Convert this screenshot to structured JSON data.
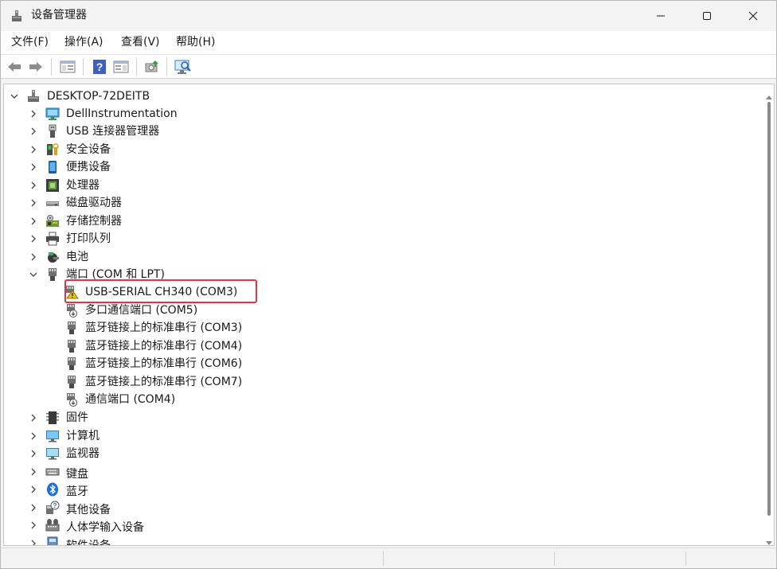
{
  "window": {
    "title": "设备管理器",
    "app_icon": "device-manager-icon"
  },
  "menu": [
    {
      "label": "文件(F)"
    },
    {
      "label": "操作(A)"
    },
    {
      "label": "查看(V)"
    },
    {
      "label": "帮助(H)"
    }
  ],
  "toolbar": [
    {
      "name": "back-arrow-icon"
    },
    {
      "name": "forward-arrow-icon"
    },
    {
      "name": "show-hide-console-tree-icon"
    },
    {
      "name": "help-icon"
    },
    {
      "name": "action-pane-icon"
    },
    {
      "name": "update-driver-icon"
    },
    {
      "name": "scan-hardware-changes-icon"
    }
  ],
  "tree": {
    "root": {
      "label": "DESKTOP-72DEITB",
      "icon": "computer-tower-icon",
      "expanded": true
    },
    "categories": [
      {
        "label": "DellInstrumentation",
        "icon": "network-monitor-icon",
        "expanded": false
      },
      {
        "label": "USB 连接器管理器",
        "icon": "usb-plug-icon",
        "expanded": false
      },
      {
        "label": "安全设备",
        "icon": "security-key-icon",
        "expanded": false
      },
      {
        "label": "便携设备",
        "icon": "portable-device-icon",
        "expanded": false
      },
      {
        "label": "处理器",
        "icon": "processor-chip-icon",
        "expanded": false
      },
      {
        "label": "磁盘驱动器",
        "icon": "disk-drive-icon",
        "expanded": false
      },
      {
        "label": "存储控制器",
        "icon": "storage-controller-icon",
        "expanded": false
      },
      {
        "label": "打印队列",
        "icon": "printer-icon",
        "expanded": false
      },
      {
        "label": "电池",
        "icon": "battery-icon",
        "expanded": false
      },
      {
        "label": "端口 (COM 和 LPT)",
        "icon": "port-connector-icon",
        "expanded": true,
        "children": [
          {
            "label": "USB-SERIAL CH340 (COM3)",
            "icon": "warning-port-icon",
            "status": "warning",
            "highlighted": true
          },
          {
            "label": "多口通信端口 (COM5)",
            "icon": "comm-port-icon"
          },
          {
            "label": "蓝牙链接上的标准串行 (COM3)",
            "icon": "port-connector-icon"
          },
          {
            "label": "蓝牙链接上的标准串行 (COM4)",
            "icon": "port-connector-icon"
          },
          {
            "label": "蓝牙链接上的标准串行 (COM6)",
            "icon": "port-connector-icon"
          },
          {
            "label": "蓝牙链接上的标准串行 (COM7)",
            "icon": "port-connector-icon"
          },
          {
            "label": "通信端口 (COM4)",
            "icon": "comm-port-icon"
          }
        ]
      },
      {
        "label": "固件",
        "icon": "firmware-chip-icon",
        "expanded": false
      },
      {
        "label": "计算机",
        "icon": "computer-monitor-icon",
        "expanded": false
      },
      {
        "label": "监视器",
        "icon": "display-monitor-icon",
        "expanded": false
      },
      {
        "label": "键盘",
        "icon": "keyboard-icon",
        "expanded": false
      },
      {
        "label": "蓝牙",
        "icon": "bluetooth-icon",
        "expanded": false
      },
      {
        "label": "其他设备",
        "icon": "unknown-device-icon",
        "expanded": false
      },
      {
        "label": "人体学输入设备",
        "icon": "hid-device-icon",
        "expanded": false
      },
      {
        "label": "软件设备",
        "icon": "software-device-icon",
        "expanded": false
      }
    ]
  },
  "colors": {
    "highlight_border": "#e0344a",
    "window_bg": "#f3f3f3",
    "warning_yellow": "#f2c200",
    "bluetooth_blue": "#1e6fd9"
  }
}
